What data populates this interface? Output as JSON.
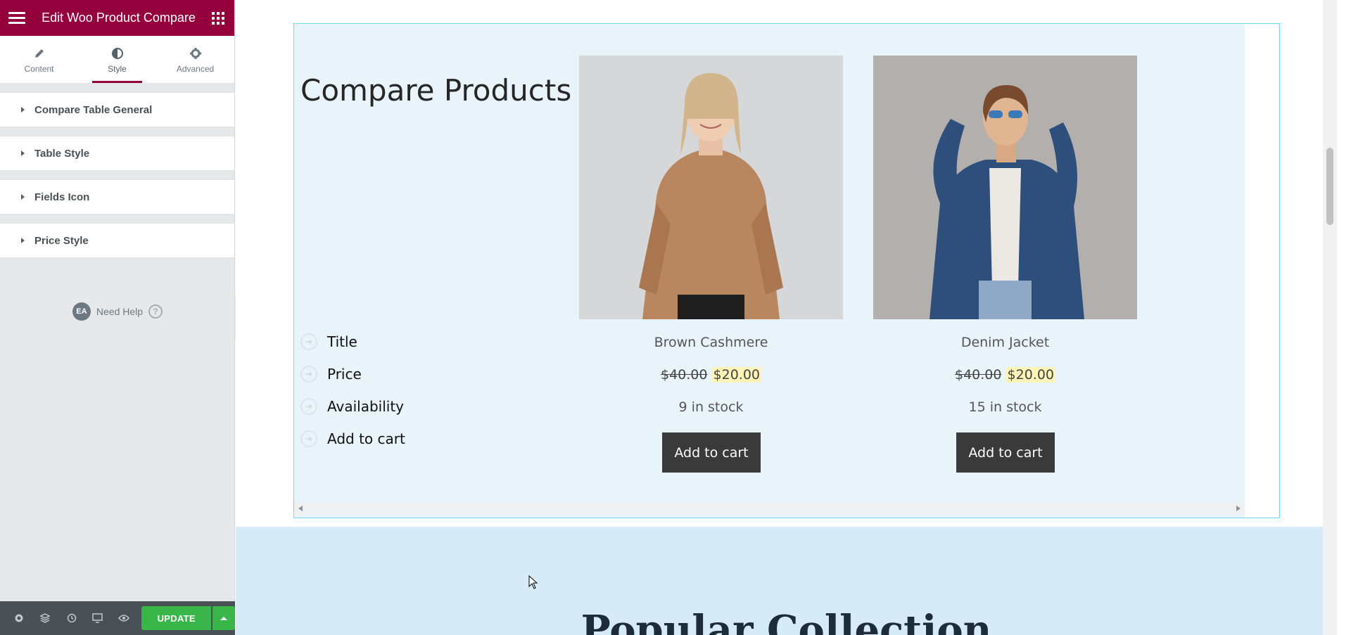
{
  "panel": {
    "title": "Edit Woo Product Compare",
    "tabs": [
      {
        "label": "Content",
        "icon": "pencil-icon"
      },
      {
        "label": "Style",
        "icon": "half-circle-icon",
        "active": true
      },
      {
        "label": "Advanced",
        "icon": "gear-icon"
      }
    ],
    "sections": [
      {
        "label": "Compare Table General"
      },
      {
        "label": "Table Style"
      },
      {
        "label": "Fields Icon"
      },
      {
        "label": "Price Style"
      }
    ],
    "need_help": {
      "badge": "EA",
      "label": "Need Help",
      "icon": "?"
    },
    "footer": {
      "update_label": "UPDATE"
    }
  },
  "compare": {
    "title": "Compare Products",
    "fields": [
      {
        "label": "Title"
      },
      {
        "label": "Price"
      },
      {
        "label": "Availability"
      },
      {
        "label": "Add to cart"
      }
    ],
    "products": [
      {
        "title": "Brown Cashmere",
        "old_price": "$40.00",
        "new_price": "$20.00",
        "availability": "9 in stock",
        "cart_label": "Add to cart"
      },
      {
        "title": "Denim Jacket",
        "old_price": "$40.00",
        "new_price": "$20.00",
        "availability": "15 in stock",
        "cart_label": "Add to cart"
      }
    ]
  },
  "popular": {
    "title": "Popular Collection"
  },
  "colors": {
    "brand": "#93003c",
    "update": "#39b54a",
    "table_bg": "#e8f4fa",
    "price_highlight": "#fff3b8"
  }
}
